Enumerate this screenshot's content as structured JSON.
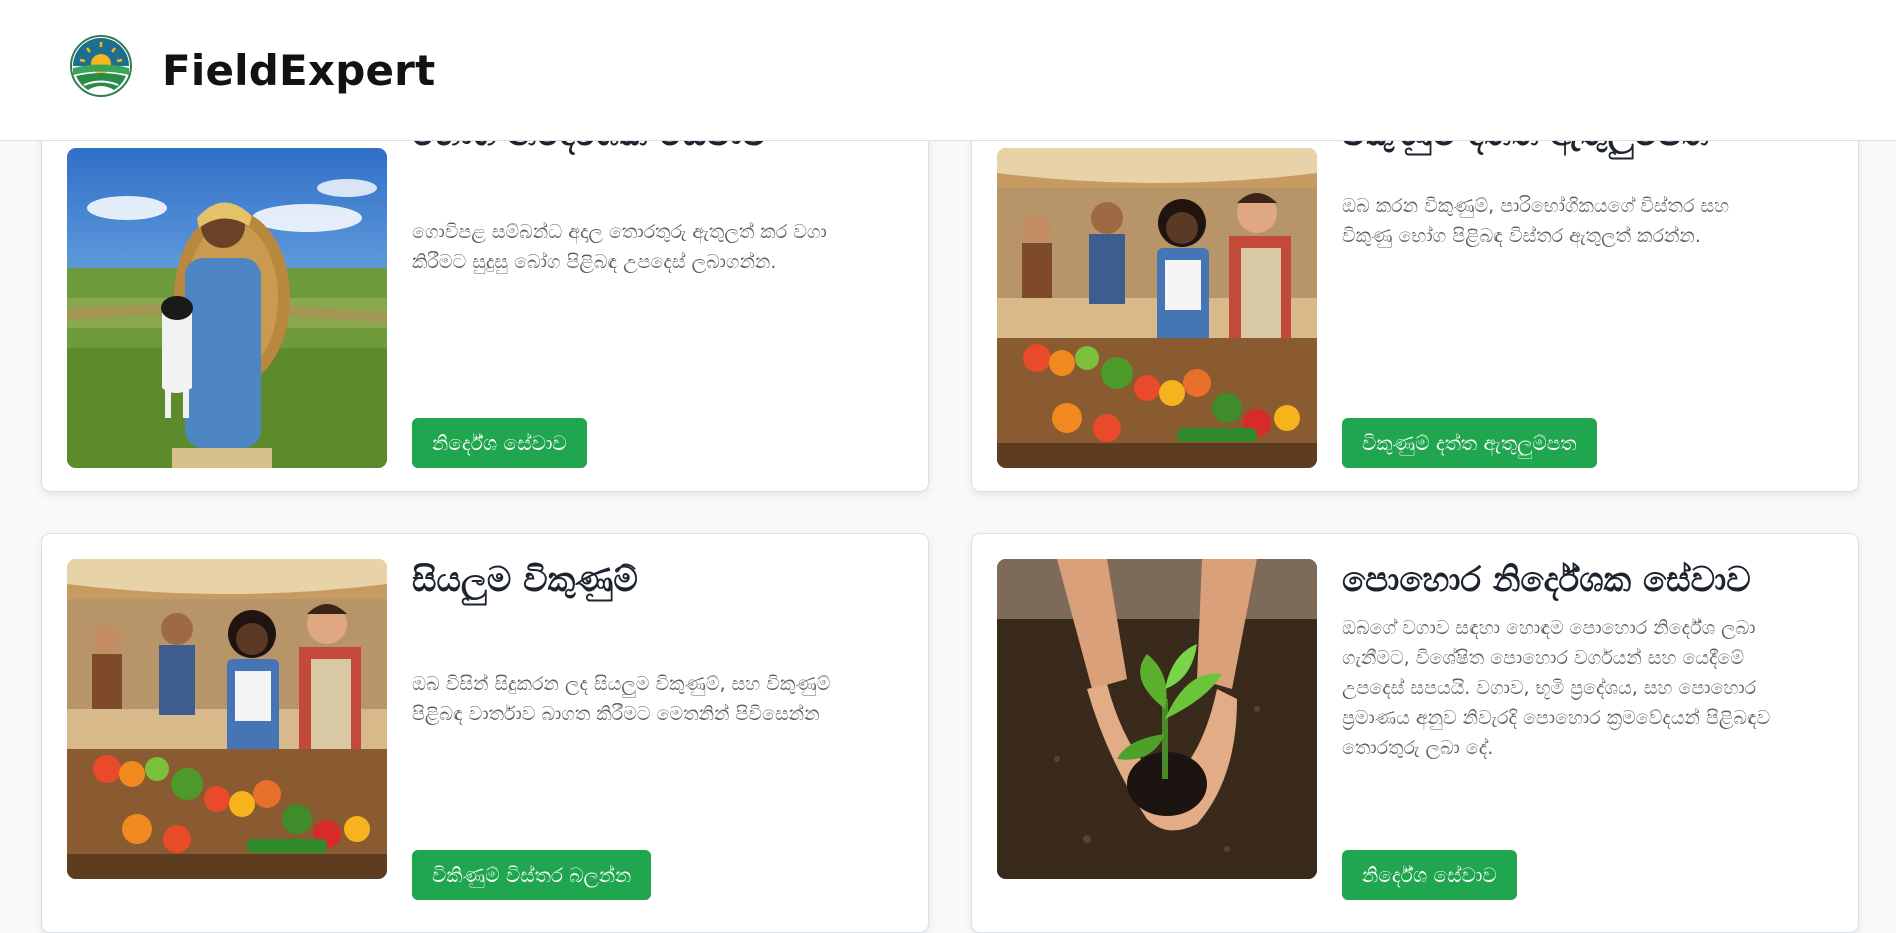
{
  "header": {
    "brand": "FieldExpert",
    "logo_icon": "sun-over-field-logo"
  },
  "colors": {
    "accent_button": "#1fa64e",
    "title_text": "#1e2330",
    "body_text": "#5a6068",
    "header_bg": "#ffffff",
    "page_bg": "#f8f9fa"
  },
  "cards": [
    {
      "title": "භෝග නිර්දේශක සේවාව",
      "description": "ගොවිපළ සම්බන්ධ අදාල තොරතුරු ඇතුලත් කර වගා කිරීමට සුදුසු බෝග පිළිබඳ උපදෙස් ලබාගන්න.",
      "button": "නිර්දේශ සේවාව",
      "image": "farmer-with-basket-and-goat"
    },
    {
      "title": "විකුණුම් දත්ත ඇතුලුම්පත",
      "description": "ඔබ කරන විකුණුම්, පාරිභෝගිකයගේ විස්තර සහ විකුණු භෝග පිළිබඳ විස්තර ඇතුලත් කරන්න.",
      "button": "විකුණුම් දත්ත ඇතුලුම්පත",
      "image": "vendors-at-vegetable-market"
    },
    {
      "title": "සියලුම විකුණුම්",
      "description": "ඔබ විසින් සිදුකරන ලද සියලුම විකුණුම්, සහ විකුණුම් පිළිබඳ වාර්තාව බාගත කිරීමට මෙතනින් පිවිසෙන්න",
      "button": "විකිණුම් විස්තර බලන්න",
      "image": "vendors-at-vegetable-market"
    },
    {
      "title": "පොහොර නිර්දේශක සේවාව",
      "description": "ඔබගේ වගාව සඳහා හොඳම පොහොර නිර්දේශ ලබා ගැනීමට, විශේෂිත පොහොර වර්ගයන් සහ යෙදීමේ උපදෙස් සපයයි. වගාව, භූමි ප්‍රදේශය, සහ පොහොර ප්‍රමාණය අනුව නිවැරදි පොහොර ක්‍රමවේදයන් පිළිබඳව තොරතුරු ලබා දේ.",
      "button": "නිර්දේශ සේවාව",
      "image": "hands-holding-seedling"
    }
  ]
}
